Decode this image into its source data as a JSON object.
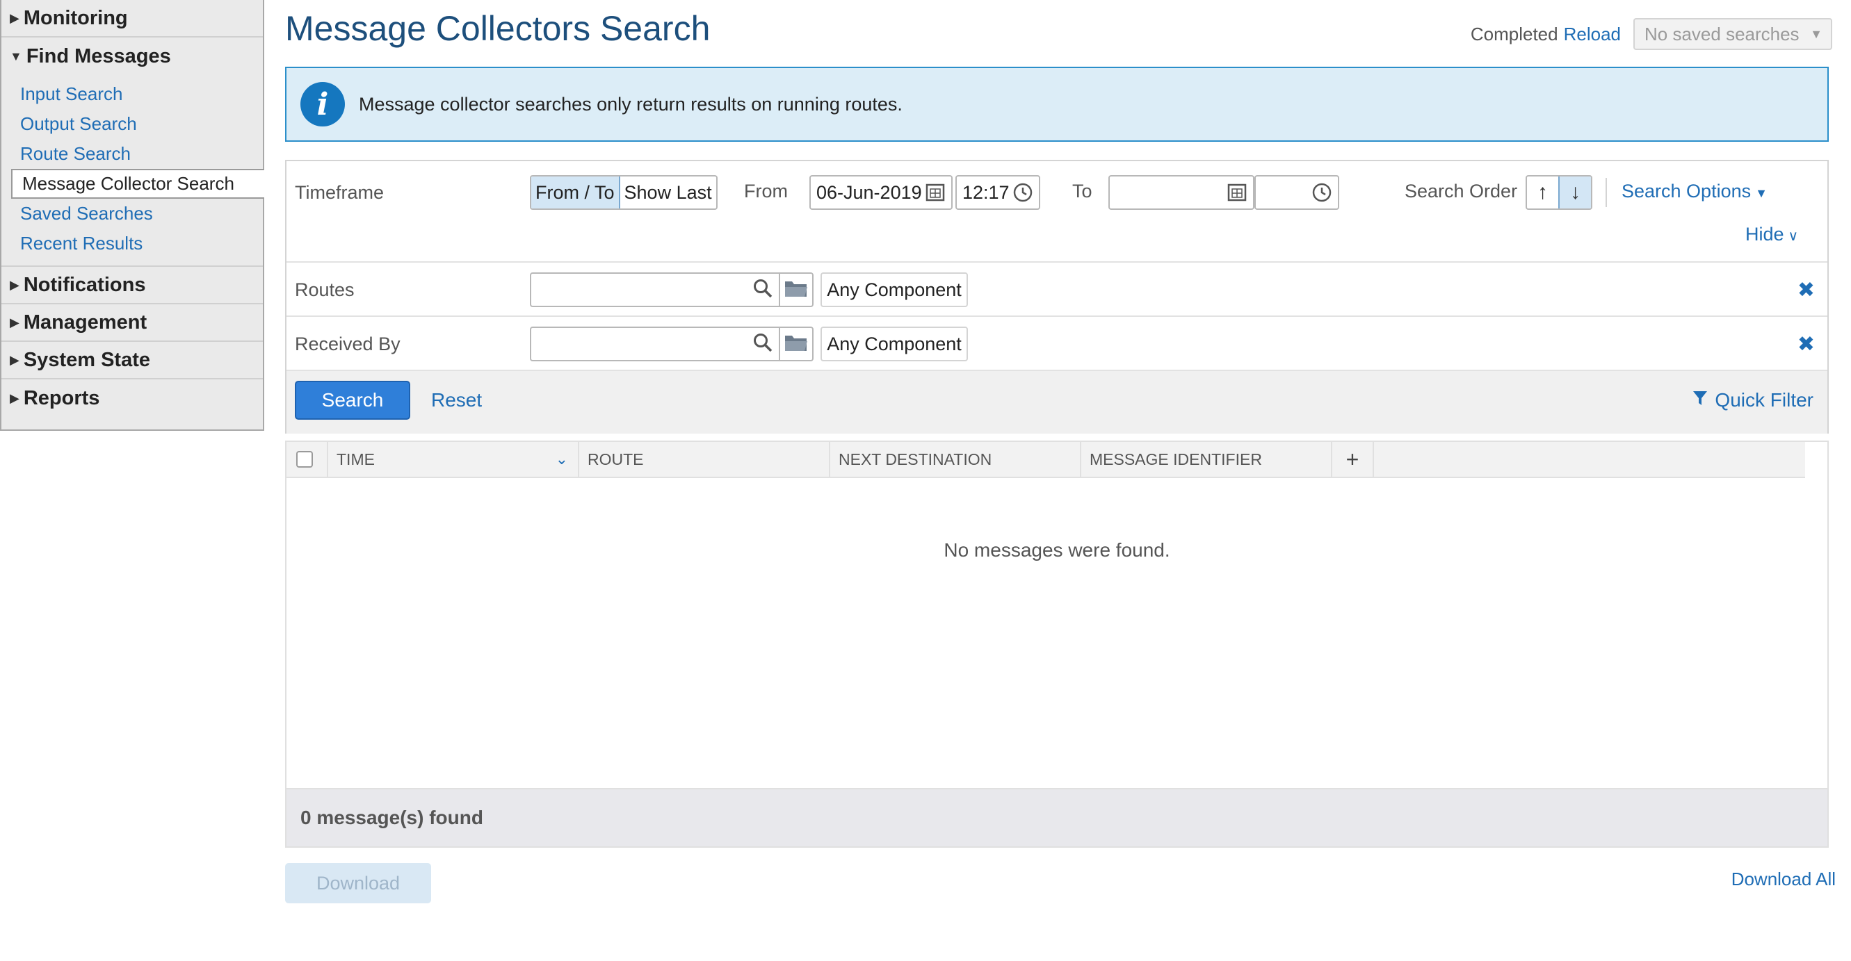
{
  "sidebar": {
    "sections": [
      {
        "label": "Monitoring",
        "expanded": false
      },
      {
        "label": "Find Messages",
        "expanded": true
      },
      {
        "label": "Notifications",
        "expanded": false
      },
      {
        "label": "Management",
        "expanded": false
      },
      {
        "label": "System State",
        "expanded": false
      },
      {
        "label": "Reports",
        "expanded": false
      }
    ],
    "find_messages_items": [
      {
        "label": "Input Search"
      },
      {
        "label": "Output Search"
      },
      {
        "label": "Route Search"
      },
      {
        "label": "Message Collector Search",
        "active": true
      },
      {
        "label": "Saved Searches"
      },
      {
        "label": "Recent Results"
      }
    ]
  },
  "header": {
    "title": "Message Collectors Search",
    "status": "Completed",
    "reload": "Reload",
    "saved_searches": "No saved searches"
  },
  "info": {
    "text": "Message collector searches only return results on running routes."
  },
  "form": {
    "timeframe_label": "Timeframe",
    "mode_from_to": "From / To",
    "mode_show_last": "Show Last",
    "from_label": "From",
    "from_date": "06-Jun-2019",
    "from_time": "12:17",
    "to_label": "To",
    "to_date": "",
    "to_time": "",
    "search_order_label": "Search Order",
    "search_options": "Search Options",
    "hide": "Hide",
    "routes_label": "Routes",
    "routes_component": "Any Component",
    "received_by_label": "Received By",
    "received_by_component": "Any Component",
    "search_button": "Search",
    "reset_button": "Reset",
    "quick_filter": "Quick Filter"
  },
  "grid": {
    "columns": [
      "TIME",
      "ROUTE",
      "NEXT DESTINATION",
      "MESSAGE IDENTIFIER"
    ],
    "empty_text": "No messages were found.",
    "count_text": "0 message(s) found"
  },
  "bottom": {
    "download": "Download",
    "download_all": "Download All"
  },
  "colors": {
    "accent": "#1f6db5",
    "info_bg": "#dcedf7",
    "primary_button": "#2f7fd9"
  }
}
